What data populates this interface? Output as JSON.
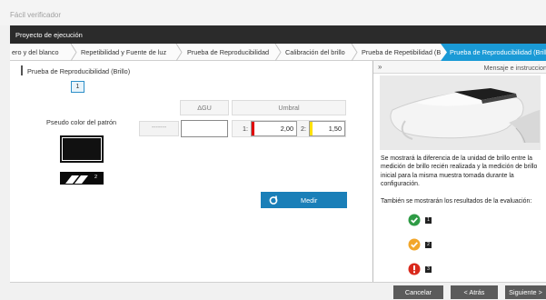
{
  "window": {
    "title": "Fácil verificador"
  },
  "project_bar": {
    "title": "Proyecto de ejecución"
  },
  "steps": [
    {
      "label": "ero y del blanco"
    },
    {
      "label": "Repetibilidad y Fuente de luz"
    },
    {
      "label": "Prueba de Reproducibilidad"
    },
    {
      "label": "Calibración del brillo"
    },
    {
      "label": "Prueba de Repetibilidad (Brillo)"
    },
    {
      "label": "Prueba de Reproducibilidad (Brillo)"
    }
  ],
  "section": {
    "title": "Prueba de Reproducibilidad (Brillo)",
    "tab": "1"
  },
  "table": {
    "dgu_header": "ΔGU",
    "umbral_header": "Umbral",
    "pseudo_color_label": "Pseudo color del patrón",
    "dash_value": "-------",
    "dgu_value": "",
    "threshold1_label": "1:",
    "threshold1_value": "2,00",
    "threshold2_label": "2:",
    "threshold2_value": "1,50"
  },
  "pattern": {
    "number": "2",
    "swatch_color": "#111111"
  },
  "measure_button": {
    "label": "Medir"
  },
  "right_panel": {
    "title": "Mensaje e instruccion",
    "message": "Se mostrará la diferencia de la unidad de brillo entre la medición de brillo recién realizada y la medición de brillo inicial para la misma muestra tomada durante la configuración.",
    "results_text": "También se mostrarán los resultados de la evaluación:",
    "statuses": [
      {
        "icon": "check-circle-icon",
        "color": "#2e9b45",
        "number": "1"
      },
      {
        "icon": "check-circle-icon",
        "color": "#f2a62a",
        "number": "2"
      },
      {
        "icon": "exclamation-circle-icon",
        "color": "#d9291c",
        "number": "3"
      }
    ]
  },
  "footer": {
    "cancel": "Cancelar",
    "back": "< Atrás",
    "next": "Siguiente >"
  },
  "colors": {
    "accent": "#1a9ad6",
    "button_blue": "#1a7fb8",
    "dark_bar": "#2b2b2b",
    "threshold1": "#e00000",
    "threshold2": "#ffe100"
  }
}
